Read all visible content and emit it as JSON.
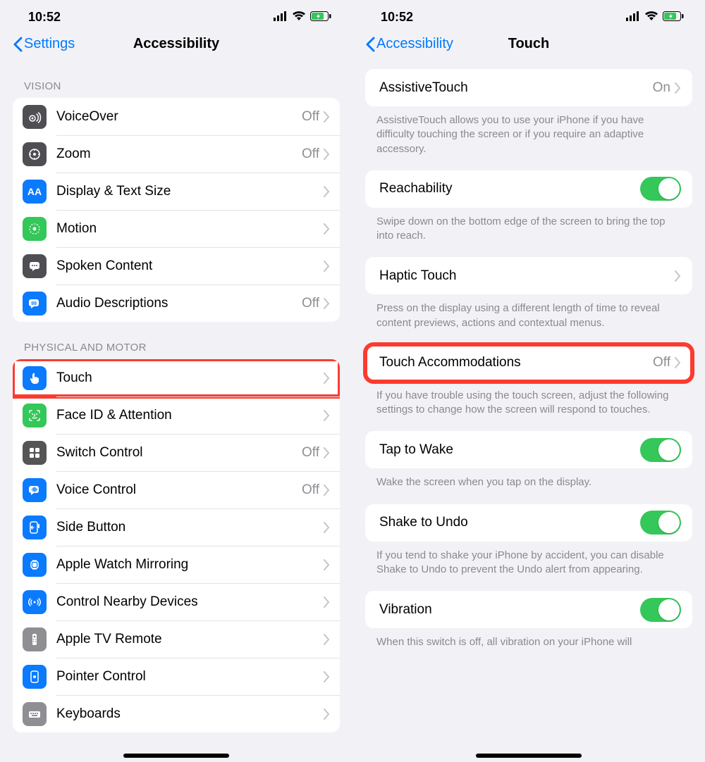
{
  "status": {
    "time": "10:52"
  },
  "left": {
    "back": "Settings",
    "title": "Accessibility",
    "sections": {
      "vision": {
        "header": "VISION",
        "items": [
          {
            "label": "VoiceOver",
            "value": "Off"
          },
          {
            "label": "Zoom",
            "value": "Off"
          },
          {
            "label": "Display & Text Size",
            "value": ""
          },
          {
            "label": "Motion",
            "value": ""
          },
          {
            "label": "Spoken Content",
            "value": ""
          },
          {
            "label": "Audio Descriptions",
            "value": "Off"
          }
        ]
      },
      "physical": {
        "header": "PHYSICAL AND MOTOR",
        "items": [
          {
            "label": "Touch",
            "value": ""
          },
          {
            "label": "Face ID & Attention",
            "value": ""
          },
          {
            "label": "Switch Control",
            "value": "Off"
          },
          {
            "label": "Voice Control",
            "value": "Off"
          },
          {
            "label": "Side Button",
            "value": ""
          },
          {
            "label": "Apple Watch Mirroring",
            "value": ""
          },
          {
            "label": "Control Nearby Devices",
            "value": ""
          },
          {
            "label": "Apple TV Remote",
            "value": ""
          },
          {
            "label": "Pointer Control",
            "value": ""
          },
          {
            "label": "Keyboards",
            "value": ""
          }
        ]
      }
    }
  },
  "right": {
    "back": "Accessibility",
    "title": "Touch",
    "groups": [
      {
        "label": "AssistiveTouch",
        "value": "On",
        "type": "link",
        "footer": "AssistiveTouch allows you to use your iPhone if you have difficulty touching the screen or if you require an adaptive accessory."
      },
      {
        "label": "Reachability",
        "type": "toggle",
        "on": true,
        "footer": "Swipe down on the bottom edge of the screen to bring the top into reach."
      },
      {
        "label": "Haptic Touch",
        "value": "",
        "type": "link",
        "footer": "Press on the display using a different length of time to reveal content previews, actions and contextual menus."
      },
      {
        "label": "Touch Accommodations",
        "value": "Off",
        "type": "link",
        "highlight": true,
        "footer": "If you have trouble using the touch screen, adjust the following settings to change how the screen will respond to touches."
      },
      {
        "label": "Tap to Wake",
        "type": "toggle",
        "on": true,
        "footer": "Wake the screen when you tap on the display."
      },
      {
        "label": "Shake to Undo",
        "type": "toggle",
        "on": true,
        "footer": "If you tend to shake your iPhone by accident, you can disable Shake to Undo to prevent the Undo alert from appearing."
      },
      {
        "label": "Vibration",
        "type": "toggle",
        "on": true,
        "footer": "When this switch is off, all vibration on your iPhone will"
      }
    ]
  }
}
